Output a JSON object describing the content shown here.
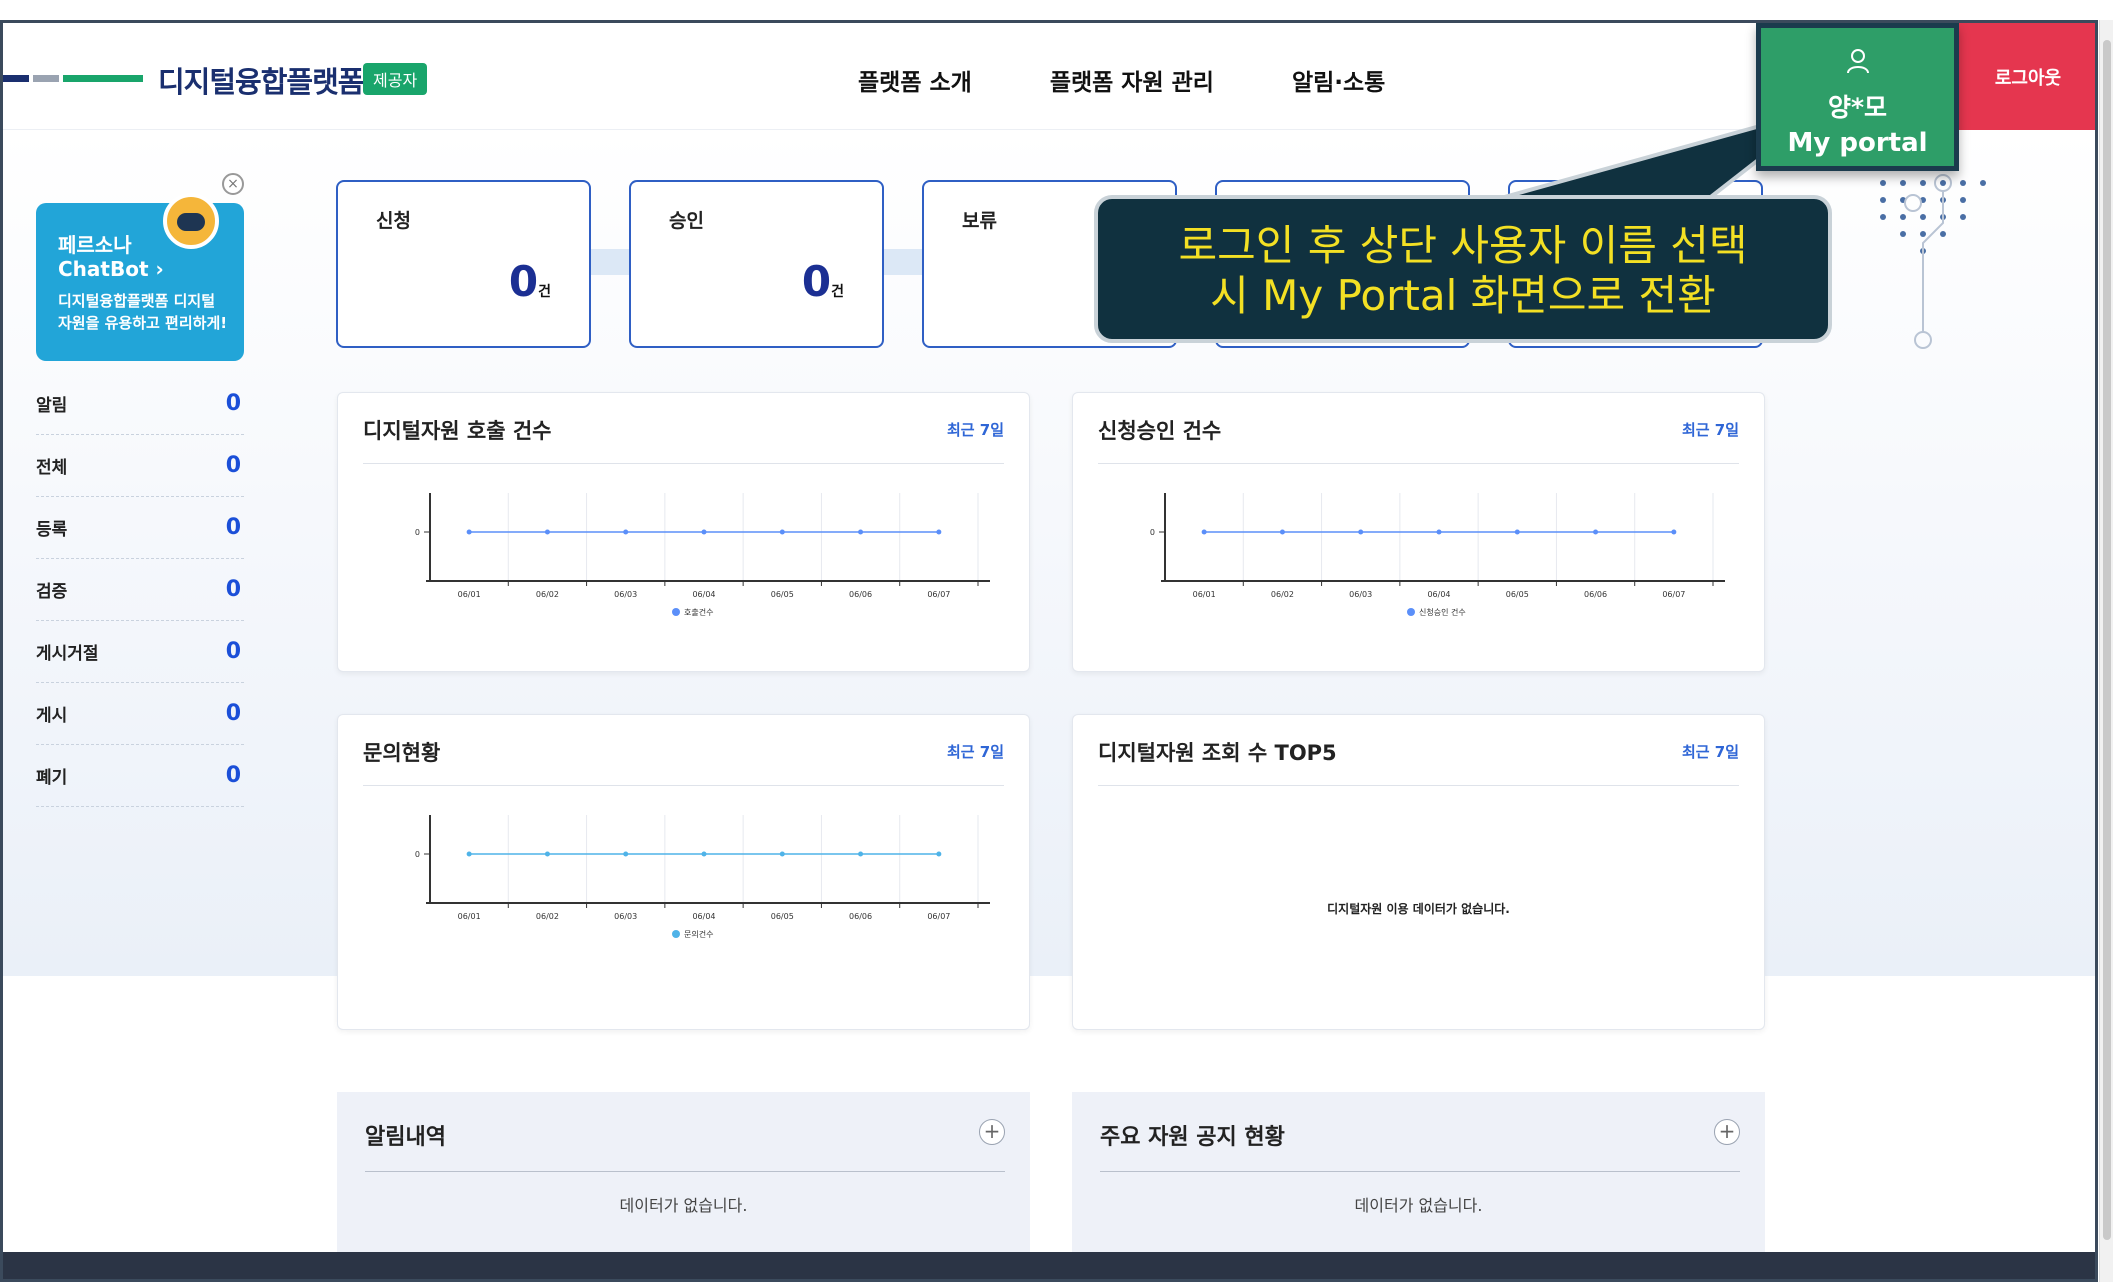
{
  "header": {
    "brand": "디지털융합플랫폼",
    "role_badge": "제공자",
    "nav": [
      "플랫폼 소개",
      "플랫폼 자원 관리",
      "알림·소통"
    ],
    "logout": "로그아웃",
    "logo_colors": [
      "#1a2f6f",
      "#9aa3b1",
      "#19a56b"
    ]
  },
  "portal": {
    "user_name": "양*모",
    "link": "My portal",
    "icon": "user-icon"
  },
  "callout": {
    "line1": "로그인 후 상단 사용자 이름 선택",
    "line2": "시 My Portal 화면으로 전환"
  },
  "chatbot": {
    "title1": "페르소나",
    "title2": "ChatBot",
    "desc": "디지털융합플랫폼 디지털 자원을 유용하고 편리하게!",
    "close": "×"
  },
  "sidebar": {
    "items": [
      {
        "label": "알림",
        "value": "0"
      },
      {
        "label": "전체",
        "value": "0"
      },
      {
        "label": "등록",
        "value": "0"
      },
      {
        "label": "검증",
        "value": "0"
      },
      {
        "label": "게시거절",
        "value": "0"
      },
      {
        "label": "게시",
        "value": "0"
      },
      {
        "label": "폐기",
        "value": "0"
      }
    ]
  },
  "stats": [
    {
      "label": "신청",
      "value": "0",
      "unit": "건"
    },
    {
      "label": "승인",
      "value": "0",
      "unit": "건"
    },
    {
      "label": "보류",
      "value": "",
      "unit": ""
    },
    {
      "label": "",
      "value": "",
      "unit": ""
    },
    {
      "label": "",
      "value": "",
      "unit": ""
    }
  ],
  "panels": {
    "calls": {
      "title": "디지털자원 호출 건수",
      "link": "최근 7일"
    },
    "approvals": {
      "title": "신청승인 건수",
      "link": "최근 7일"
    },
    "inquiries": {
      "title": "문의현황",
      "link": "최근 7일"
    },
    "top5": {
      "title": "디지털자원 조회 수 TOP5",
      "link": "최근 7일",
      "empty": "디지털자원 이용 데이터가 없습니다."
    }
  },
  "bottom": {
    "notices": {
      "title": "알림내역",
      "empty": "데이터가 없습니다."
    },
    "resources": {
      "title": "주요 자원 공지 현황",
      "empty": "데이터가 없습니다."
    },
    "plus": "+"
  },
  "chart_data": [
    {
      "type": "line",
      "categories": [
        "06/01",
        "06/02",
        "06/03",
        "06/04",
        "06/05",
        "06/06",
        "06/07"
      ],
      "series": [
        {
          "name": "호출건수",
          "values": [
            0,
            0,
            0,
            0,
            0,
            0,
            0
          ],
          "color": "#5b8ff9"
        }
      ],
      "yticks": [
        "0"
      ],
      "legend": "bottom",
      "grid": true
    },
    {
      "type": "line",
      "categories": [
        "06/01",
        "06/02",
        "06/03",
        "06/04",
        "06/05",
        "06/06",
        "06/07"
      ],
      "series": [
        {
          "name": "신청승인 건수",
          "values": [
            0,
            0,
            0,
            0,
            0,
            0,
            0
          ],
          "color": "#5b8ff9"
        }
      ],
      "yticks": [
        "0"
      ],
      "legend": "bottom",
      "grid": true
    },
    {
      "type": "line",
      "categories": [
        "06/01",
        "06/02",
        "06/03",
        "06/04",
        "06/05",
        "06/06",
        "06/07"
      ],
      "series": [
        {
          "name": "문의건수",
          "values": [
            0,
            0,
            0,
            0,
            0,
            0,
            0
          ],
          "color": "#4fb3e8"
        }
      ],
      "yticks": [
        "0"
      ],
      "legend": "bottom",
      "grid": true
    }
  ]
}
